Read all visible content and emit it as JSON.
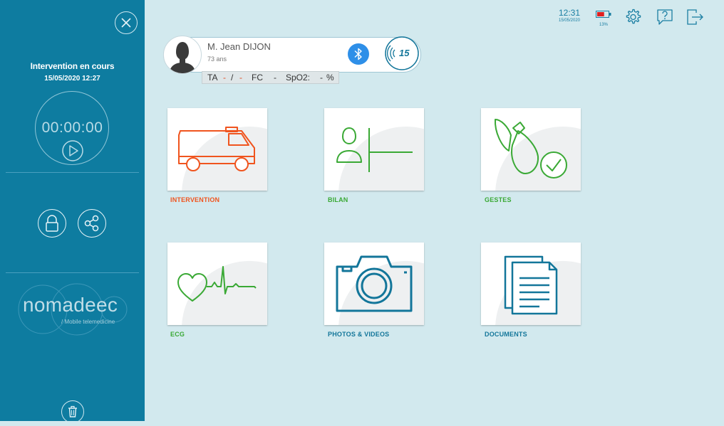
{
  "sidebar": {
    "status_title": "Intervention en cours",
    "status_datetime": "15/05/2020 12:27",
    "timer": "00:00:00",
    "logo_text": "nomadeec",
    "logo_subtitle": "/ Mobile telemedicine"
  },
  "header": {
    "time": "12:31",
    "date": "15/05/2020",
    "battery_percent": "13%",
    "battery_level": 0.13
  },
  "patient": {
    "name": "M. Jean DIJON",
    "age": "73 ans",
    "badge_number": "15",
    "vitals": {
      "ta_label": "TA",
      "ta_sys": "-",
      "ta_sep": "/",
      "ta_dia": "-",
      "fc_label": "FC",
      "fc_value": "-",
      "spo2_label": "SpO2:",
      "spo2_value": "-",
      "spo2_unit": "%"
    }
  },
  "tiles": [
    {
      "label": "INTERVENTION",
      "icon": "ambulance-icon",
      "color": "#f0541e"
    },
    {
      "label": "BILAN",
      "icon": "patient-assessment-icon",
      "color": "#3aa935"
    },
    {
      "label": "GESTES",
      "icon": "medical-gestures-icon",
      "color": "#3aa935"
    },
    {
      "label": "ECG",
      "icon": "ecg-heart-icon",
      "color": "#3aa935"
    },
    {
      "label": "PHOTOS & VIDEOS",
      "icon": "camera-icon",
      "color": "#13769a"
    },
    {
      "label": "DOCUMENTS",
      "icon": "documents-icon",
      "color": "#13769a"
    }
  ],
  "colors": {
    "sidebar": "#0e7ca0",
    "background": "#d2e9ee",
    "accent_blue": "#1a7ea2",
    "bluetooth": "#2e8fe8",
    "alert_red": "#e24d25"
  }
}
